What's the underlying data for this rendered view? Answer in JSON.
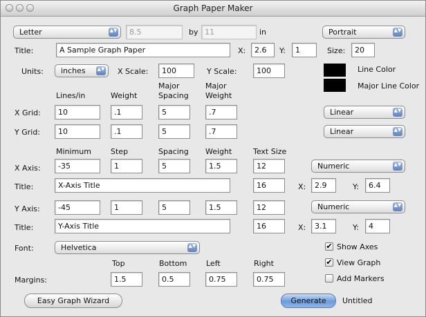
{
  "window": {
    "title": "Graph Paper Maker"
  },
  "page": {
    "paper_size": "Letter",
    "width": "8.5",
    "by_label": "by",
    "height": "11",
    "unit_label": "in",
    "orientation": "Portrait"
  },
  "title_row": {
    "label": "Title:",
    "value": "A Sample Graph Paper",
    "x_label": "X:",
    "x_value": "2.6",
    "y_label": "Y:",
    "y_value": "1",
    "size_label": "Size:",
    "size_value": "20"
  },
  "units_row": {
    "label": "Units:",
    "units_value": "inches",
    "x_scale_label": "X Scale:",
    "x_scale_value": "100",
    "y_scale_label": "Y Scale:",
    "y_scale_value": "100"
  },
  "colors": {
    "line_color_label": "Line Color",
    "line_color": "#000000",
    "major_line_color_label": "Major Line Color",
    "major_line_color": "#000000"
  },
  "grid": {
    "headers": {
      "lines_per_in": "Lines/in",
      "weight": "Weight",
      "major_spacing_line1": "Major",
      "major_spacing_line2": "Spacing",
      "major_weight_line1": "Major",
      "major_weight_line2": "Weight"
    },
    "x": {
      "label": "X Grid:",
      "lines_per_in": "10",
      "weight": ".1",
      "major_spacing": "5",
      "major_weight": ".7",
      "scale_type": "Linear"
    },
    "y": {
      "label": "Y Grid:",
      "lines_per_in": "10",
      "weight": ".1",
      "major_spacing": "5",
      "major_weight": ".7",
      "scale_type": "Linear"
    }
  },
  "axes": {
    "headers": {
      "minimum": "Minimum",
      "step": "Step",
      "spacing": "Spacing",
      "weight": "Weight",
      "text_size": "Text Size"
    },
    "x": {
      "label": "X Axis:",
      "minimum": "-35",
      "step": "1",
      "spacing": "5",
      "weight": "1.5",
      "text_size": "12",
      "format": "Numeric",
      "title_label": "Title:",
      "title_value": "X-Axis Title",
      "title_size": "16",
      "x_label": "X:",
      "x_value": "2.9",
      "y_label": "Y:",
      "y_value": "6.4"
    },
    "y": {
      "label": "Y Axis:",
      "minimum": "-45",
      "step": "1",
      "spacing": "5",
      "weight": "1.5",
      "text_size": "12",
      "format": "Numeric",
      "title_label": "Title:",
      "title_value": "Y-Axis Title",
      "title_size": "16",
      "x_label": "X:",
      "x_value": "3.1",
      "y_label": "Y:",
      "y_value": "4"
    }
  },
  "font_row": {
    "label": "Font:",
    "value": "Helvetica"
  },
  "checkboxes": {
    "show_axes": {
      "label": "Show Axes",
      "checked": true,
      "mark": "✔"
    },
    "view_graph": {
      "label": "View Graph",
      "checked": true,
      "mark": "✔"
    },
    "add_markers": {
      "label": "Add Markers",
      "checked": false,
      "mark": ""
    }
  },
  "margins": {
    "label": "Margins:",
    "top_label": "Top",
    "bottom_label": "Bottom",
    "left_label": "Left",
    "right_label": "Right",
    "top": "1.5",
    "bottom": "0.5",
    "left": "0.75",
    "right": "0.75"
  },
  "footer": {
    "wizard_button": "Easy Graph Wizard",
    "generate_button": "Generate",
    "status": "Untitled"
  },
  "icons": {
    "popup_arrows": "▲▼"
  }
}
